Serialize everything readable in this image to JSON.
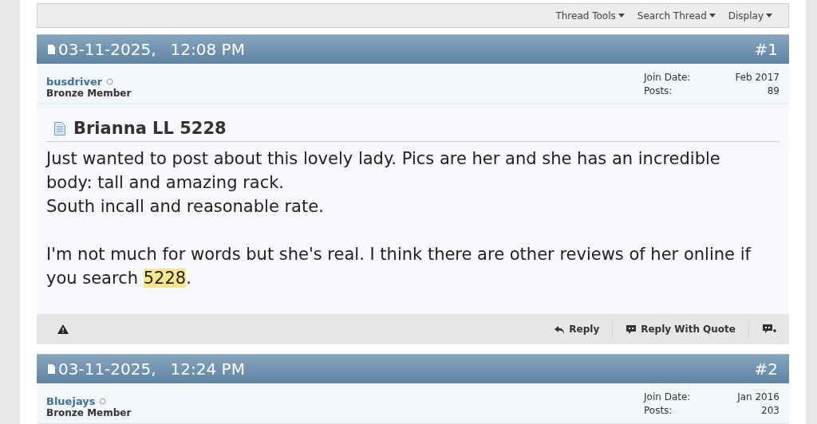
{
  "toolbar": {
    "items": [
      {
        "label": "Thread Tools"
      },
      {
        "label": "Search Thread"
      },
      {
        "label": "Display"
      }
    ]
  },
  "posts": [
    {
      "date": "03-11-2025,",
      "time": "12:08 PM",
      "number": "#1",
      "username": "busdriver",
      "online": false,
      "rank": "Bronze Member",
      "join_date_label": "Join Date:",
      "join_date": "Feb 2017",
      "posts_label": "Posts:",
      "posts": "89",
      "title": "Brianna LL 5228",
      "paragraphs": [
        [
          {
            "text": "Just wanted to post about this lovely lady. Pics are her and she has an incredible body: tall and amazing rack.",
            "highlighted": false
          }
        ],
        [
          {
            "text": "South incall and reasonable rate.",
            "highlighted": false
          }
        ],
        [
          {
            "text": "I'm not much for words but she's real. I think there are other reviews of her online if you search ",
            "highlighted": false
          },
          {
            "text": "5228",
            "highlighted": true
          },
          {
            "text": ".",
            "highlighted": false
          }
        ]
      ],
      "actions": [
        {
          "label": "Reply",
          "kind": "reply"
        },
        {
          "label": "Reply With Quote",
          "kind": "quote"
        }
      ]
    },
    {
      "date": "03-11-2025,",
      "time": "12:24 PM",
      "number": "#2",
      "username": "Bluejays",
      "online": false,
      "rank": "Bronze Member",
      "join_date_label": "Join Date:",
      "join_date": "Jan 2016",
      "posts_label": "Posts:",
      "posts": "203"
    }
  ]
}
